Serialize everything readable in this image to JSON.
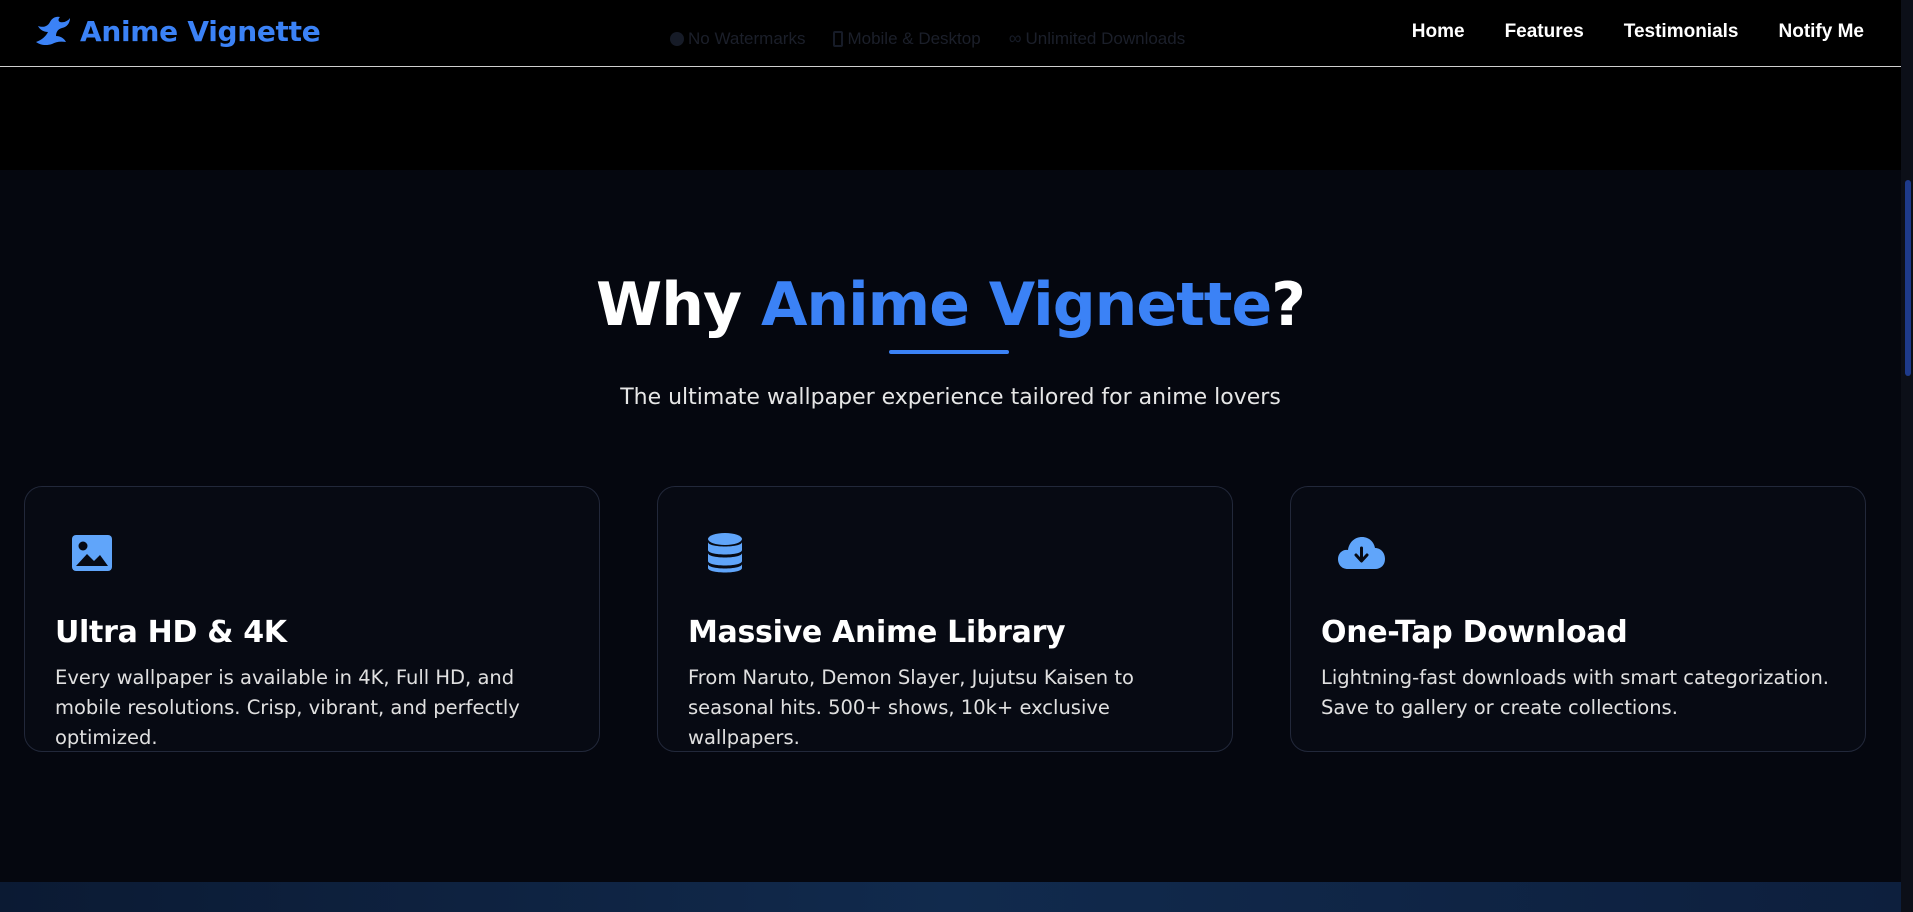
{
  "brand": {
    "name": "Anime Vignette"
  },
  "header_features": [
    {
      "label": "No Watermarks",
      "icon": "check-circle-icon"
    },
    {
      "label": "Mobile & Desktop",
      "icon": "mobile-icon"
    },
    {
      "label": "Unlimited Downloads",
      "icon": "infinity-icon"
    }
  ],
  "nav": {
    "items": [
      {
        "label": "Home"
      },
      {
        "label": "Features"
      },
      {
        "label": "Testimonials"
      },
      {
        "label": "Notify Me"
      }
    ]
  },
  "section": {
    "title_prefix": "Why ",
    "title_accent": "Anime Vignette",
    "title_suffix": "?",
    "subtitle": "The ultimate wallpaper experience tailored for anime lovers"
  },
  "cards": [
    {
      "icon": "image-icon",
      "title": "Ultra HD & 4K",
      "description": "Every wallpaper is available in 4K, Full HD, and mobile resolutions. Crisp, vibrant, and perfectly optimized."
    },
    {
      "icon": "database-icon",
      "title": "Massive Anime Library",
      "description": "From Naruto, Demon Slayer, Jujutsu Kaisen to seasonal hits. 500+ shows, 10k+ exclusive wallpapers."
    },
    {
      "icon": "cloud-download-icon",
      "title": "One-Tap Download",
      "description": "Lightning-fast downloads with smart categorization. Save to gallery or create collections."
    }
  ],
  "colors": {
    "accent": "#3b82f6",
    "background": "#05070f",
    "nav_background": "#000000"
  }
}
